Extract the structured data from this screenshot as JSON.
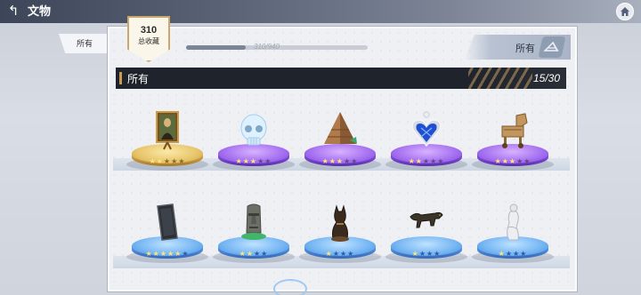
{
  "topbar": {
    "title": "文物"
  },
  "side_tab": {
    "label": "所有"
  },
  "badge": {
    "count": "310",
    "label": "总收藏"
  },
  "progress": {
    "text": "310/940",
    "value": 310,
    "max": 940
  },
  "filter": {
    "label": "所有"
  },
  "section": {
    "title": "所有",
    "count": "15/30"
  },
  "rows": [
    {
      "items": [
        {
          "name": "mona-lisa-painting",
          "rarity": "gold",
          "stars_on": 2,
          "stars_total": 5
        },
        {
          "name": "crystal-skull",
          "rarity": "purple",
          "stars_on": 3,
          "stars_total": 5
        },
        {
          "name": "pyramid",
          "rarity": "purple",
          "stars_on": 3,
          "stars_total": 5
        },
        {
          "name": "heart-pendant",
          "rarity": "purple",
          "stars_on": 2,
          "stars_total": 5
        },
        {
          "name": "trojan-horse",
          "rarity": "purple",
          "stars_on": 3,
          "stars_total": 5
        }
      ]
    },
    {
      "items": [
        {
          "name": "monolith-slab",
          "rarity": "blue",
          "stars_on": 5,
          "stars_total": 6
        },
        {
          "name": "moai-statue",
          "rarity": "blue",
          "stars_on": 2,
          "stars_total": 4
        },
        {
          "name": "bastet-cat-statue",
          "rarity": "blue",
          "stars_on": 1,
          "stars_total": 4
        },
        {
          "name": "leopard-figurine",
          "rarity": "blue",
          "stars_on": 1,
          "stars_total": 4
        },
        {
          "name": "venus-statue",
          "rarity": "blue",
          "stars_on": 1,
          "stars_total": 4
        }
      ]
    }
  ]
}
